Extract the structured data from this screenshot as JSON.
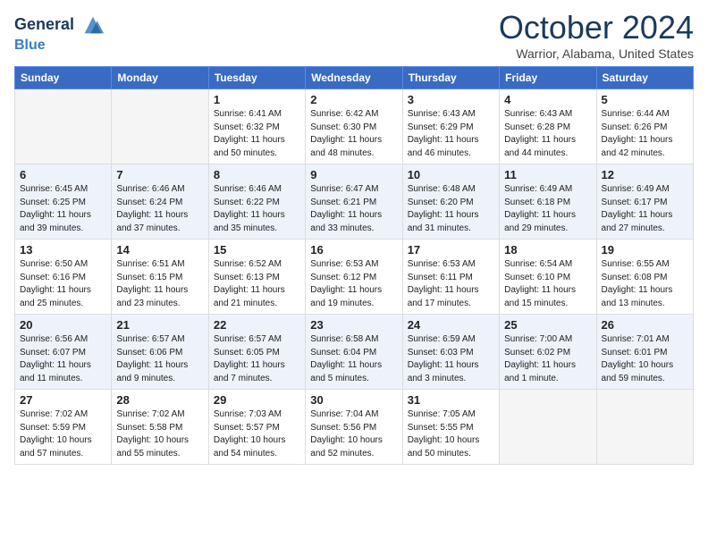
{
  "header": {
    "logo_line1": "General",
    "logo_line2": "Blue",
    "month_title": "October 2024",
    "location": "Warrior, Alabama, United States"
  },
  "weekdays": [
    "Sunday",
    "Monday",
    "Tuesday",
    "Wednesday",
    "Thursday",
    "Friday",
    "Saturday"
  ],
  "weeks": [
    [
      {
        "day": "",
        "info": ""
      },
      {
        "day": "",
        "info": ""
      },
      {
        "day": "1",
        "info": "Sunrise: 6:41 AM\nSunset: 6:32 PM\nDaylight: 11 hours and 50 minutes."
      },
      {
        "day": "2",
        "info": "Sunrise: 6:42 AM\nSunset: 6:30 PM\nDaylight: 11 hours and 48 minutes."
      },
      {
        "day": "3",
        "info": "Sunrise: 6:43 AM\nSunset: 6:29 PM\nDaylight: 11 hours and 46 minutes."
      },
      {
        "day": "4",
        "info": "Sunrise: 6:43 AM\nSunset: 6:28 PM\nDaylight: 11 hours and 44 minutes."
      },
      {
        "day": "5",
        "info": "Sunrise: 6:44 AM\nSunset: 6:26 PM\nDaylight: 11 hours and 42 minutes."
      }
    ],
    [
      {
        "day": "6",
        "info": "Sunrise: 6:45 AM\nSunset: 6:25 PM\nDaylight: 11 hours and 39 minutes."
      },
      {
        "day": "7",
        "info": "Sunrise: 6:46 AM\nSunset: 6:24 PM\nDaylight: 11 hours and 37 minutes."
      },
      {
        "day": "8",
        "info": "Sunrise: 6:46 AM\nSunset: 6:22 PM\nDaylight: 11 hours and 35 minutes."
      },
      {
        "day": "9",
        "info": "Sunrise: 6:47 AM\nSunset: 6:21 PM\nDaylight: 11 hours and 33 minutes."
      },
      {
        "day": "10",
        "info": "Sunrise: 6:48 AM\nSunset: 6:20 PM\nDaylight: 11 hours and 31 minutes."
      },
      {
        "day": "11",
        "info": "Sunrise: 6:49 AM\nSunset: 6:18 PM\nDaylight: 11 hours and 29 minutes."
      },
      {
        "day": "12",
        "info": "Sunrise: 6:49 AM\nSunset: 6:17 PM\nDaylight: 11 hours and 27 minutes."
      }
    ],
    [
      {
        "day": "13",
        "info": "Sunrise: 6:50 AM\nSunset: 6:16 PM\nDaylight: 11 hours and 25 minutes."
      },
      {
        "day": "14",
        "info": "Sunrise: 6:51 AM\nSunset: 6:15 PM\nDaylight: 11 hours and 23 minutes."
      },
      {
        "day": "15",
        "info": "Sunrise: 6:52 AM\nSunset: 6:13 PM\nDaylight: 11 hours and 21 minutes."
      },
      {
        "day": "16",
        "info": "Sunrise: 6:53 AM\nSunset: 6:12 PM\nDaylight: 11 hours and 19 minutes."
      },
      {
        "day": "17",
        "info": "Sunrise: 6:53 AM\nSunset: 6:11 PM\nDaylight: 11 hours and 17 minutes."
      },
      {
        "day": "18",
        "info": "Sunrise: 6:54 AM\nSunset: 6:10 PM\nDaylight: 11 hours and 15 minutes."
      },
      {
        "day": "19",
        "info": "Sunrise: 6:55 AM\nSunset: 6:08 PM\nDaylight: 11 hours and 13 minutes."
      }
    ],
    [
      {
        "day": "20",
        "info": "Sunrise: 6:56 AM\nSunset: 6:07 PM\nDaylight: 11 hours and 11 minutes."
      },
      {
        "day": "21",
        "info": "Sunrise: 6:57 AM\nSunset: 6:06 PM\nDaylight: 11 hours and 9 minutes."
      },
      {
        "day": "22",
        "info": "Sunrise: 6:57 AM\nSunset: 6:05 PM\nDaylight: 11 hours and 7 minutes."
      },
      {
        "day": "23",
        "info": "Sunrise: 6:58 AM\nSunset: 6:04 PM\nDaylight: 11 hours and 5 minutes."
      },
      {
        "day": "24",
        "info": "Sunrise: 6:59 AM\nSunset: 6:03 PM\nDaylight: 11 hours and 3 minutes."
      },
      {
        "day": "25",
        "info": "Sunrise: 7:00 AM\nSunset: 6:02 PM\nDaylight: 11 hours and 1 minute."
      },
      {
        "day": "26",
        "info": "Sunrise: 7:01 AM\nSunset: 6:01 PM\nDaylight: 10 hours and 59 minutes."
      }
    ],
    [
      {
        "day": "27",
        "info": "Sunrise: 7:02 AM\nSunset: 5:59 PM\nDaylight: 10 hours and 57 minutes."
      },
      {
        "day": "28",
        "info": "Sunrise: 7:02 AM\nSunset: 5:58 PM\nDaylight: 10 hours and 55 minutes."
      },
      {
        "day": "29",
        "info": "Sunrise: 7:03 AM\nSunset: 5:57 PM\nDaylight: 10 hours and 54 minutes."
      },
      {
        "day": "30",
        "info": "Sunrise: 7:04 AM\nSunset: 5:56 PM\nDaylight: 10 hours and 52 minutes."
      },
      {
        "day": "31",
        "info": "Sunrise: 7:05 AM\nSunset: 5:55 PM\nDaylight: 10 hours and 50 minutes."
      },
      {
        "day": "",
        "info": ""
      },
      {
        "day": "",
        "info": ""
      }
    ]
  ]
}
